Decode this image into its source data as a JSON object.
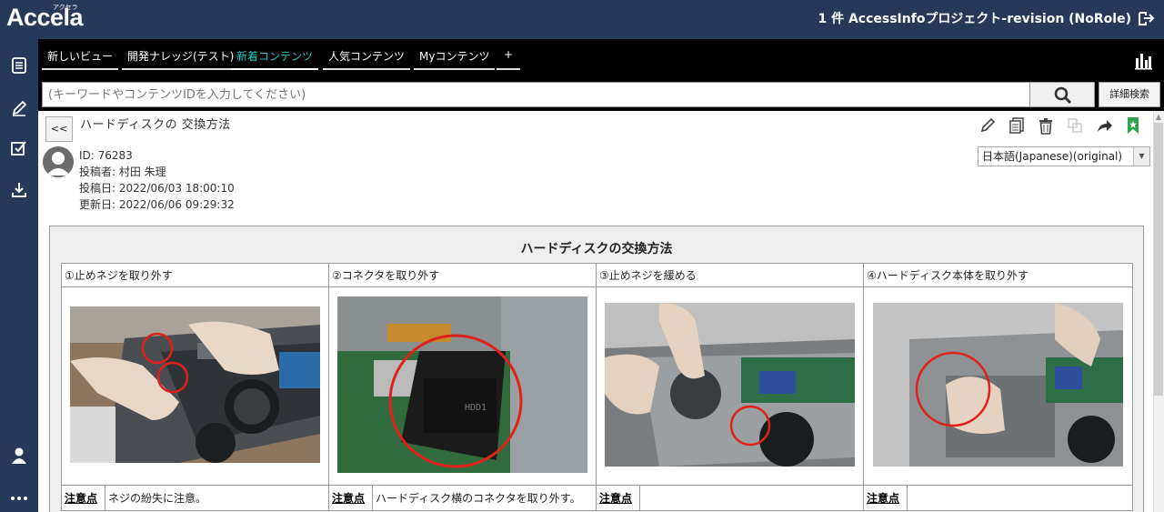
{
  "header": {
    "logo": "Accela",
    "logo_kana": "アクセラ",
    "project_info": "1 件  AccessInfoプロジェクト-revision (NoRole)"
  },
  "tabs": [
    {
      "label": "新しいビュー"
    },
    {
      "label": "開発ナレッジ(テスト)"
    },
    {
      "label": "新着コンテンツ"
    },
    {
      "label": "人気コンテンツ"
    },
    {
      "label": "Myコンテンツ"
    },
    {
      "label": "+"
    }
  ],
  "search": {
    "placeholder": "(キーワードやコンテンツIDを入力してください)",
    "advanced_label": "詳細検索"
  },
  "article": {
    "back_label": "<<",
    "title": "ハードディスクの 交換方法",
    "id_line": "ID: 76283",
    "author_line": "投稿者: 村田 朱理",
    "posted_line": "投稿日: 2022/06/03 18:00:10",
    "updated_line": "更新日: 2022/06/06 09:29:32",
    "language": "日本語(Japanese)(original)"
  },
  "document": {
    "title": "ハードディスクの交換方法",
    "note_label": "注意点",
    "steps": [
      {
        "heading": "①止めネジを取り外す",
        "note": "ネジの紛失に注意。"
      },
      {
        "heading": "②コネクタを取り外す",
        "note": "ハードディスク横のコネクタを取り外す。"
      },
      {
        "heading": "③止めネジを緩める",
        "note": ""
      },
      {
        "heading": "④ハードディスク本体を取り外す",
        "note": ""
      }
    ]
  },
  "colors": {
    "navy": "#26395a",
    "active_tab": "#29c6c6",
    "bookmark_green": "#2ea44f",
    "highlight_red": "#e0201b"
  }
}
